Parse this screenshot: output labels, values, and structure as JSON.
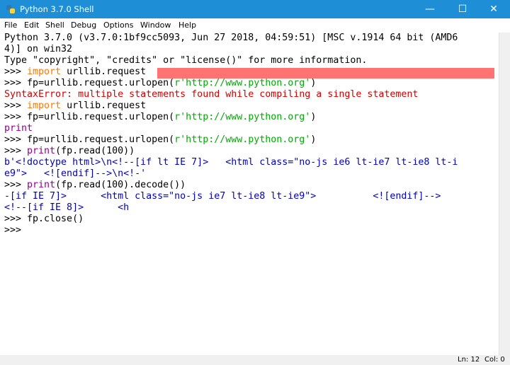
{
  "window": {
    "title": "Python 3.7.0 Shell"
  },
  "controls": {
    "minimize": "—",
    "maximize": "☐",
    "close": "✕"
  },
  "menu": [
    "File",
    "Edit",
    "Shell",
    "Debug",
    "Options",
    "Window",
    "Help"
  ],
  "shell": {
    "lines": [
      "Python 3.7.0 (v3.7.0:1bf9cc5093, Jun 27 2018, 04:59:51) [MSC v.1914 64 bit (AMD6",
      "4)] on win32",
      "Type \"copyright\", \"credits\" or \"license()\" for more information.",
      [
        ">>> ",
        "import",
        " urllib.request"
      ],
      [
        ">>> fp=urllib.request.urlopen(",
        "r'http://www.python.org'",
        ")"
      ],
      "SyntaxError: multiple statements found while compiling a single statement",
      [
        ">>> ",
        "import",
        " urllib.request"
      ],
      [
        ">>> fp=urllib.request.urlopen(",
        "r'http://www.python.org'",
        ")"
      ],
      "print",
      [
        ">>> fp=urllib.request.urlopen(",
        "r'http://www.python.org'",
        ")"
      ],
      [
        ">>> ",
        "print",
        "(fp.read(100))"
      ],
      "b'<!doctype html>\\n<!--[if lt IE 7]>   <html class=\"no-js ie6 lt-ie7 lt-ie8 lt-i",
      "e9\">   <![endif]-->\\n<!-'",
      [
        ">>> ",
        "print",
        "(fp.read(100).decode())"
      ],
      "-[if IE 7]>      <html class=\"no-js ie7 lt-ie8 lt-ie9\">          <![endif]-->",
      "<!--[if IE 8]>      <h",
      ">>> fp.close()",
      ">>> "
    ]
  },
  "status": {
    "line": "Ln: 12",
    "col": "Col: 0"
  }
}
